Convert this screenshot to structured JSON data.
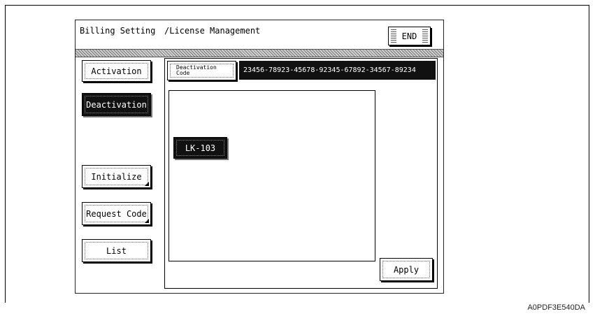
{
  "header": {
    "title_left": "Billing Setting",
    "title_right": "/License Management",
    "end_label": "END"
  },
  "sidebar": {
    "items": [
      {
        "label": "Activation",
        "selected": false
      },
      {
        "label": "Deactivation",
        "selected": true
      },
      {
        "label": "Initialize",
        "selected": false
      },
      {
        "label": "Request Code",
        "selected": false
      },
      {
        "label": "List",
        "selected": false
      }
    ]
  },
  "main": {
    "deactivation_code_label_line1": "Deactivation",
    "deactivation_code_label_line2": "Code",
    "deactivation_code_value": "23456-78923-45678-92345-67892-34567-89234",
    "license_items": [
      {
        "label": "LK-103",
        "selected": true
      }
    ],
    "apply_label": "Apply"
  },
  "figure_code": "A0PDF3E540DA",
  "colors": {
    "selected_bg": "#111111",
    "selected_text": "#ffffff",
    "background": "#ffffff"
  }
}
